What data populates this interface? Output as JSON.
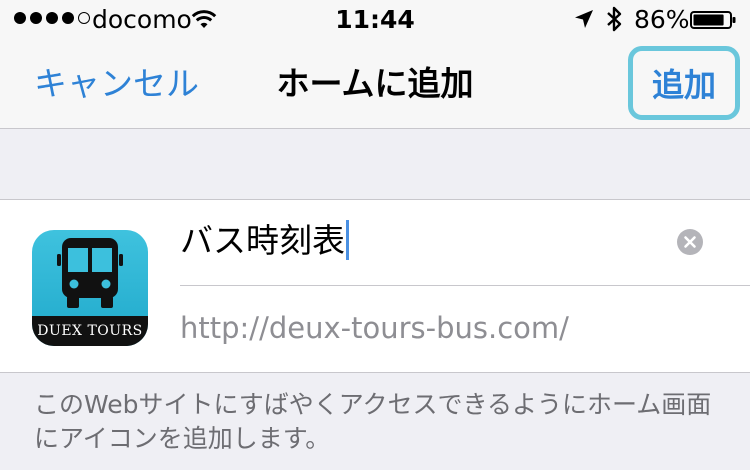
{
  "status_bar": {
    "carrier": "docomo",
    "time": "11:44",
    "battery_percent": "86%",
    "signal_bars_filled": 4,
    "signal_bars_total": 5,
    "battery_level": 0.86,
    "icons": [
      "signal-dots-icon",
      "wifi-icon",
      "location-arrow-icon",
      "bluetooth-icon",
      "battery-icon"
    ]
  },
  "nav": {
    "cancel_label": "キャンセル",
    "title": "ホームに追加",
    "add_label": "追加",
    "highlight_color": "#6ac7dc",
    "accent_color": "#2e82d6"
  },
  "form": {
    "app_icon": {
      "name": "bus-icon",
      "label": "DUEX TOURS",
      "color": "#29b5d6"
    },
    "title_value": "バス時刻表",
    "clear_icon": "clear-circle-icon",
    "url": "http://deux-tours-bus.com/"
  },
  "footer": {
    "note": "このWebサイトにすばやくアクセスできるようにホーム画面にアイコンを追加します。"
  }
}
